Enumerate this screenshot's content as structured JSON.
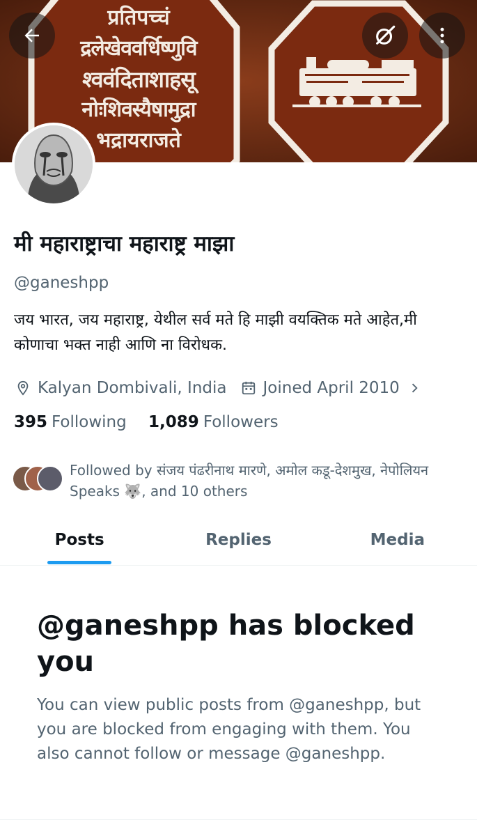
{
  "profile": {
    "display_name": "मी महाराष्ट्राचा महाराष्ट्र माझा",
    "handle": "@ganeshpp",
    "bio": "जय भारत, जय महाराष्ट्र, येथील सर्व मते हि माझी वयक्तिक मते आहेत,मी कोणाचा भक्त नाही आणि ना विरोधक.",
    "location": "Kalyan Dombivali, India",
    "joined": "Joined April 2010",
    "following_count": "395",
    "following_label": "Following",
    "followers_count": "1,089",
    "followers_label": "Followers",
    "followed_by": "Followed by संजय पंढरीनाथ मारणे, अमोल कडू-देशमुख, नेपोलियन Speaks 🐺, and 10 others"
  },
  "banner": {
    "seal_lines": [
      "प्रतिपच्चं",
      "द्रलेखेववर्धिष्णुवि",
      "श्ववंदिताशाहसू",
      "नोःशिवस्यैषामुद्रा",
      "भद्रायराजते"
    ],
    "colors": {
      "background": "#6a2d14",
      "seal_fill": "#7b2a10",
      "seal_border": "#f3ece3"
    }
  },
  "tabs": [
    {
      "label": "Posts",
      "active": true
    },
    {
      "label": "Replies",
      "active": false
    },
    {
      "label": "Media",
      "active": false
    }
  ],
  "blocked": {
    "title": "@ganeshpp has blocked you",
    "description": "You can view public posts from @ganeshpp, but you are blocked from engaging with them. You also cannot follow or message @ganeshpp."
  },
  "icons": {
    "back": "arrow-left-icon",
    "grok": "grok-icon",
    "more": "more-vertical-icon",
    "location": "location-pin-icon",
    "calendar": "calendar-icon",
    "chevron": "chevron-right-icon"
  },
  "colors": {
    "accent": "#1d9bf0",
    "text_primary": "#0f1419",
    "text_secondary": "#536471"
  }
}
